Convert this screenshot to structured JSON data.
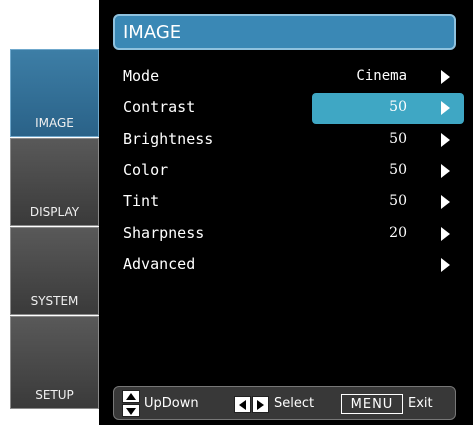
{
  "sidebar": {
    "tabs": [
      {
        "label": "IMAGE",
        "active": true
      },
      {
        "label": "DISPLAY",
        "active": false
      },
      {
        "label": "SYSTEM",
        "active": false
      },
      {
        "label": "SETUP",
        "active": false
      }
    ]
  },
  "header": {
    "title": "IMAGE"
  },
  "menu": {
    "items": [
      {
        "label": "Mode",
        "value": "Cinema"
      },
      {
        "label": "Contrast",
        "value": "50",
        "selected": true
      },
      {
        "label": "Brightness",
        "value": "50"
      },
      {
        "label": "Color",
        "value": "50"
      },
      {
        "label": "Tint",
        "value": "50"
      },
      {
        "label": "Sharpness",
        "value": "20"
      },
      {
        "label": "Advanced",
        "value": ""
      }
    ]
  },
  "footer": {
    "updown_label": "UpDown",
    "select_label": "Select",
    "menu_key": "MENU",
    "exit_label": "Exit"
  },
  "colors": {
    "accent": "#3a88b5",
    "highlight": "#3fa7c4",
    "background": "#000000"
  },
  "icons": [
    "updown-key-icon",
    "left-right-key-icon",
    "arrow-right-icon"
  ]
}
